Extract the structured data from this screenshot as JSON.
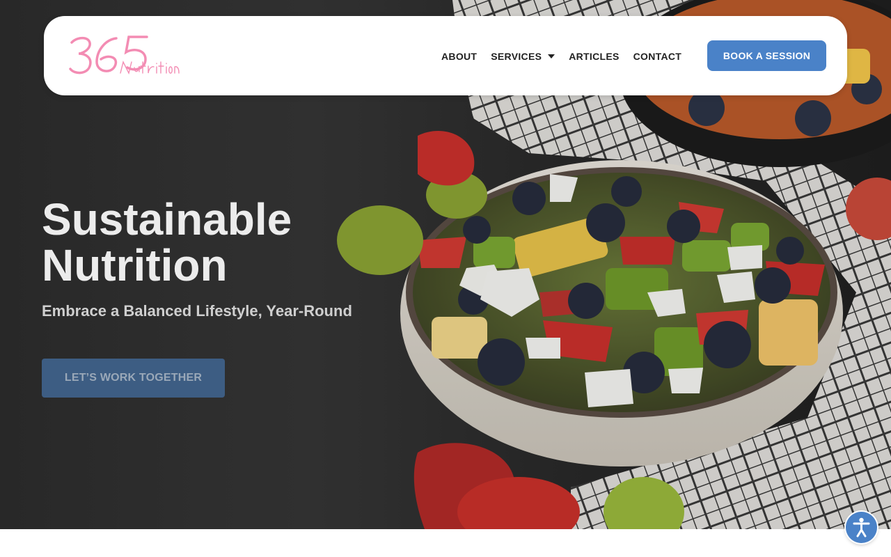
{
  "brand": {
    "logo_number": "365",
    "logo_script": "Nutrition",
    "logo_color": "#f38cb3"
  },
  "nav": {
    "items": [
      {
        "label": "ABOUT"
      },
      {
        "label": "SERVICES",
        "has_dropdown": true
      },
      {
        "label": "ARTICLES"
      },
      {
        "label": "CONTACT"
      }
    ],
    "cta_label": "BOOK A SESSION"
  },
  "hero": {
    "title": "Sustainable\nNutrition",
    "subtitle": "Embrace a Balanced Lifestyle, Year-Round",
    "cta_label": "LET’S WORK TOGETHER"
  },
  "accessibility": {
    "icon": "accessibility-icon"
  },
  "colors": {
    "accent": "#4a82c8",
    "hero_cta": "#3d5d83",
    "text_dark": "#222222",
    "hero_text": "#ececec"
  }
}
